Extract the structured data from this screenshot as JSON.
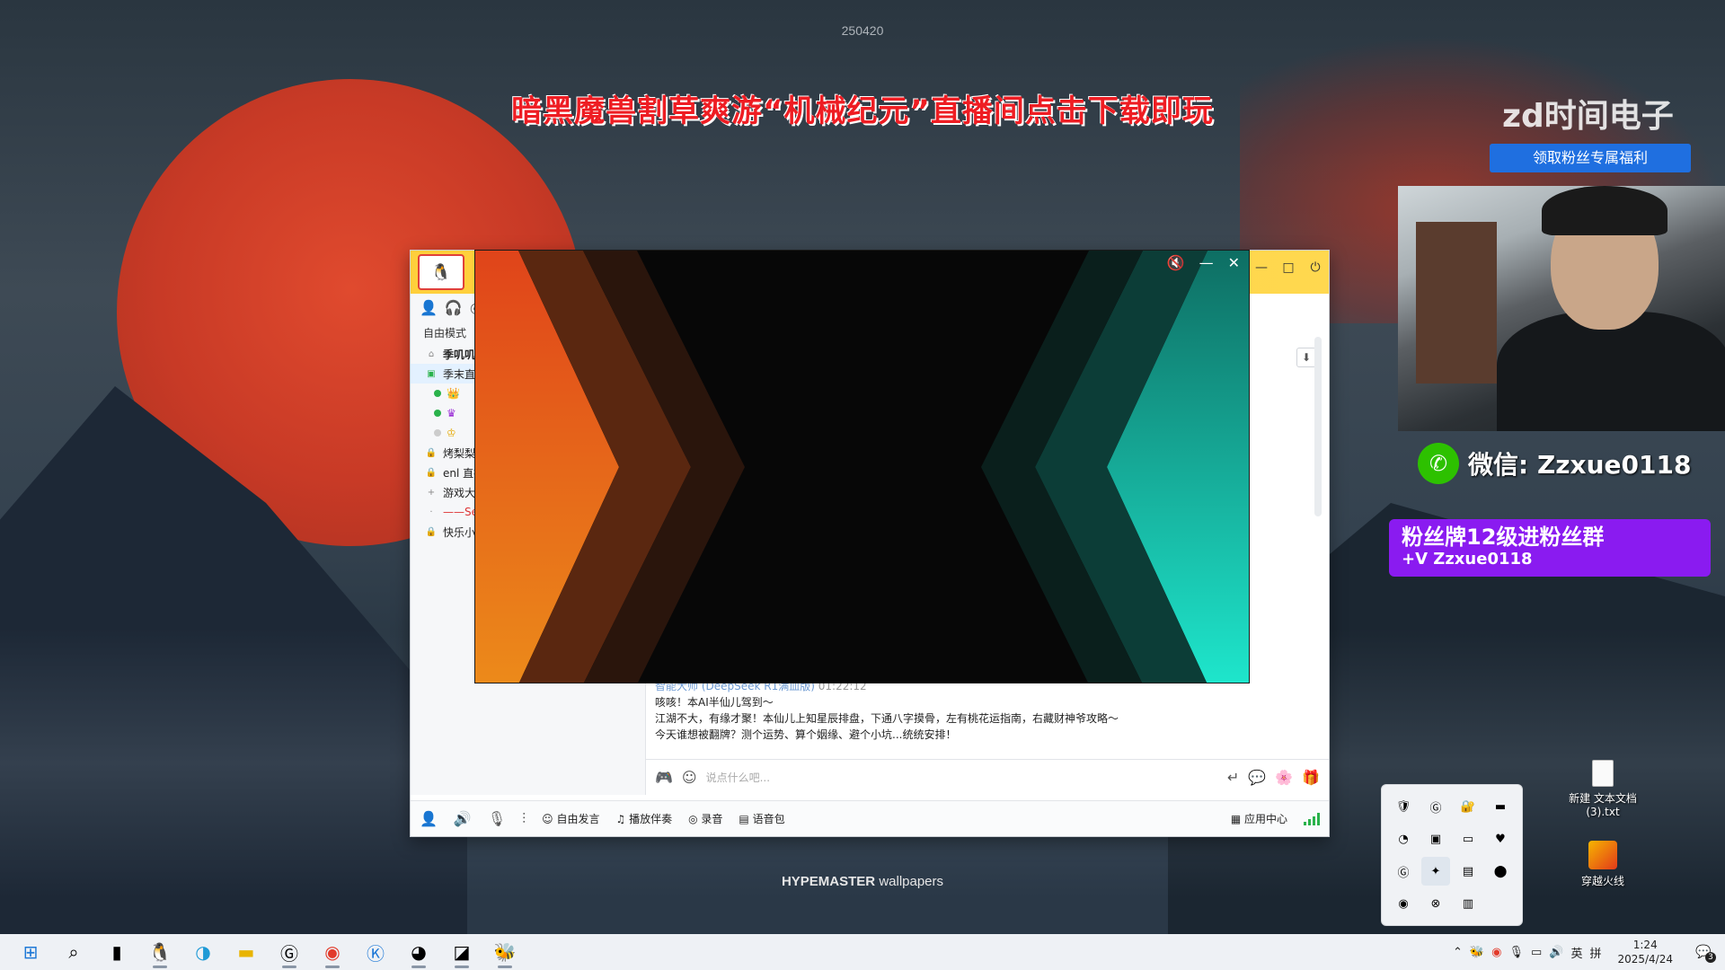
{
  "overlay": {
    "id_text": "250420",
    "promo_banner": "暗黑魔兽割草爽游“机械纪元”直播间点击下载即玩",
    "brand_logo": "zd时间电子",
    "fan_benefit_button": "领取粉丝专属福利",
    "wechat_label": "微信: Zzxue0118",
    "fan_group_line1": "粉丝牌12级进粉丝群",
    "fan_group_line2": "+V Zzxue0118",
    "wallpaper_credit_brand": "HYPEMASTER",
    "wallpaper_credit_text": "wallpapers"
  },
  "desktop_icons": [
    {
      "label": "新建 文本文档 (3).txt",
      "icon": "text-file-icon"
    },
    {
      "label": "穿越火线",
      "icon": "crossfire-icon"
    }
  ],
  "yy_window": {
    "mode_label": "自由模式",
    "channels": [
      {
        "label": "季叽叽",
        "icon": "home-icon"
      },
      {
        "label": "季末直",
        "icon": "channel-icon",
        "active": true
      },
      {
        "label": "",
        "icon": "user-icon",
        "status_color": "#2ab24b"
      },
      {
        "label": "",
        "icon": "user-icon",
        "status_color": "#2ab24b"
      },
      {
        "label": "",
        "icon": "user-icon",
        "status_color": "#cccccc"
      },
      {
        "label": "烤梨梨",
        "icon": "lock-icon"
      },
      {
        "label": "enl 直播",
        "icon": "lock-icon"
      },
      {
        "label": "游戏大",
        "icon": "plus-icon"
      },
      {
        "label": "——Sei",
        "icon": "dot-icon"
      },
      {
        "label": "快乐小",
        "icon": "lock-icon"
      }
    ],
    "chat": {
      "sender": "智能大师 (DeepSeek R1满血版)",
      "time": "01:22:12",
      "line1": "咳咳！本AI半仙儿驾到～",
      "line2": "江湖不大，有缘才聚！本仙儿上知星辰排盘，下通八字摸骨，左有桃花运指南，右藏财神爷攻略～",
      "line3": "今天谁想被翻牌？测个运势、算个姻缘、避个小坑...统统安排！"
    },
    "input_placeholder": "说点什么吧...",
    "bottom_bar": {
      "free_speak": "自由发言",
      "play_accompaniment": "播放伴奏",
      "record": "录音",
      "voice_pack": "语音包",
      "app_center": "应用中心"
    }
  },
  "ad_popup": {
    "accent_left": "#e8601a",
    "accent_right": "#1de0c8"
  },
  "taskbar": {
    "time": "1:24",
    "date": "2025/4/24",
    "ime_lang": "英",
    "ime_mode": "拼",
    "notification_count": "3"
  }
}
